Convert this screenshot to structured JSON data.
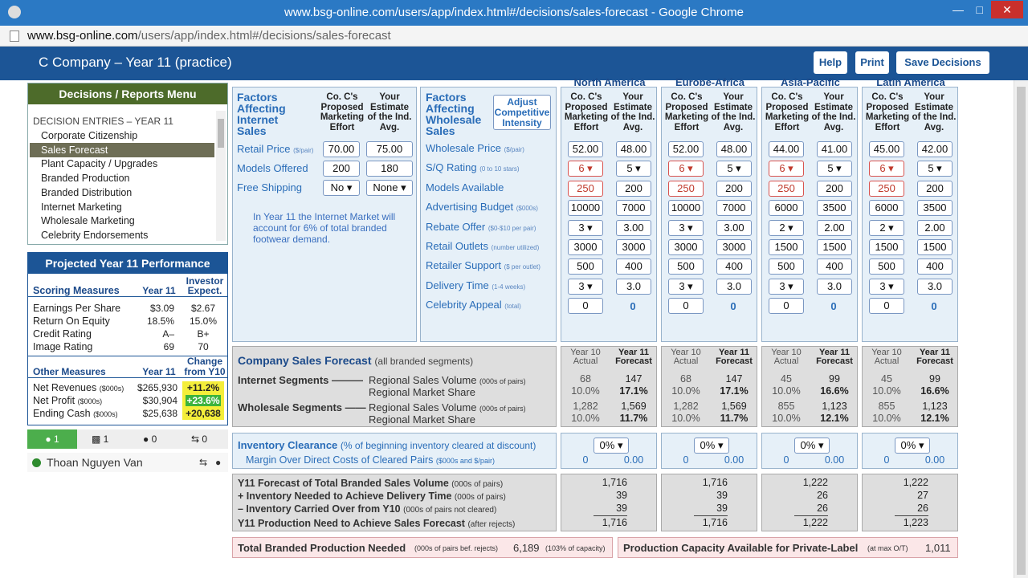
{
  "browser": {
    "window_title": "www.bsg-online.com/users/app/index.html#/decisions/sales-forecast - Google Chrome",
    "url_host": "www.bsg-online.com",
    "url_path": "/users/app/index.html#/decisions/sales-forecast"
  },
  "header": {
    "company": "C Company – Year 11 (practice)",
    "help": "Help",
    "print": "Print",
    "save": "Save Decisions"
  },
  "menu": {
    "title": "Decisions / Reports Menu",
    "section": "DECISION  ENTRIES – YEAR 11",
    "items": [
      "Corporate Citizenship",
      "Sales Forecast",
      "Plant Capacity / Upgrades",
      "Branded Production",
      "Branded Distribution",
      "Internet Marketing",
      "Wholesale Marketing",
      "Celebrity Endorsements"
    ],
    "selected": 1
  },
  "perf": {
    "title": "Projected Year 11 Performance",
    "scoring_hdr": "Scoring Measures",
    "year_hdr": "Year 11",
    "investor_hdr1": "Investor",
    "investor_hdr2": "Expect.",
    "scoring": [
      {
        "label": "Earnings Per Share",
        "y11": "$3.09",
        "exp": "$2.67"
      },
      {
        "label": "Return On Equity",
        "y11": "18.5%",
        "exp": "15.0%"
      },
      {
        "label": "Credit Rating",
        "y11": "A–",
        "exp": "B+"
      },
      {
        "label": "Image Rating",
        "y11": "69",
        "exp": "70"
      }
    ],
    "other_hdr": "Other Measures",
    "change_hdr1": "Change",
    "change_hdr2": "from Y10",
    "other": [
      {
        "label": "Net Revenues",
        "unit": "($000s)",
        "y11": "$265,930",
        "chg": "+11.2%"
      },
      {
        "label": "Net Profit",
        "unit": "($000s)",
        "y11": "$30,904",
        "chg": "+23.6%"
      },
      {
        "label": "Ending Cash",
        "unit": "($000s)",
        "y11": "$25,638",
        "chg": "+20,638"
      }
    ]
  },
  "social": {
    "people": "1",
    "comments": "1",
    "mic": "0",
    "share": "0",
    "user": "Thoan Nguyen Van"
  },
  "internet": {
    "title": "Factors Affecting Internet Sales",
    "h1": "Co. C's Proposed Marketing Effort",
    "h2": "Your Estimate of the Ind. Avg.",
    "rows": [
      {
        "label": "Retail Price",
        "unit": "($/pair)",
        "a": "70.00",
        "b": "75.00"
      },
      {
        "label": "Models Offered",
        "unit": "",
        "a": "200",
        "b": "180"
      },
      {
        "label": "Free Shipping",
        "unit": "",
        "a": "No",
        "b": "None"
      }
    ],
    "note": "In Year 11 the Internet Market will account for 6% of total branded footwear demand."
  },
  "wholesale": {
    "title": "Factors Affecting Wholesale Sales",
    "adjust": "Adjust Competitive Intensity",
    "rows": [
      {
        "label": "Wholesale Price",
        "unit": "($/pair)"
      },
      {
        "label": "S/Q Rating",
        "unit": "(0 to 10 stars)"
      },
      {
        "label": "Models Available",
        "unit": ""
      },
      {
        "label": "Advertising Budget",
        "unit": "($000s)"
      },
      {
        "label": "Rebate Offer",
        "unit": "($0-$10 per pair)"
      },
      {
        "label": "Retail Outlets",
        "unit": "(number utilized)"
      },
      {
        "label": "Retailer Support",
        "unit": "($ per outlet)"
      },
      {
        "label": "Delivery Time",
        "unit": "(1-4 weeks)"
      },
      {
        "label": "Celebrity Appeal",
        "unit": "(total)"
      }
    ]
  },
  "region_hdr": {
    "h1": "Co. C's Proposed Marketing Effort",
    "h2": "Your Estimate of the Ind. Avg."
  },
  "regions": [
    {
      "name": "North America",
      "vals": [
        [
          "52.00",
          "48.00"
        ],
        [
          "6",
          "5"
        ],
        [
          "250",
          "200"
        ],
        [
          "10000",
          "7000"
        ],
        [
          "3",
          "3.00"
        ],
        [
          "3000",
          "3000"
        ],
        [
          "500",
          "400"
        ],
        [
          "3",
          "3.0"
        ],
        [
          "0",
          "0"
        ]
      ],
      "fc": {
        "i_y10_vol": "68",
        "i_y11_vol": "147",
        "i_y10_sh": "10.0%",
        "i_y11_sh": "17.1%",
        "w_y10_vol": "1,282",
        "w_y11_vol": "1,569",
        "w_y10_sh": "10.0%",
        "w_y11_sh": "11.7%"
      },
      "inv": {
        "pct": "0%",
        "a": "0",
        "b": "0.00"
      },
      "tot": [
        "1,716",
        "39",
        "39",
        "1,716"
      ]
    },
    {
      "name": "Europe-Africa",
      "vals": [
        [
          "52.00",
          "48.00"
        ],
        [
          "6",
          "5"
        ],
        [
          "250",
          "200"
        ],
        [
          "10000",
          "7000"
        ],
        [
          "3",
          "3.00"
        ],
        [
          "3000",
          "3000"
        ],
        [
          "500",
          "400"
        ],
        [
          "3",
          "3.0"
        ],
        [
          "0",
          "0"
        ]
      ],
      "fc": {
        "i_y10_vol": "68",
        "i_y11_vol": "147",
        "i_y10_sh": "10.0%",
        "i_y11_sh": "17.1%",
        "w_y10_vol": "1,282",
        "w_y11_vol": "1,569",
        "w_y10_sh": "10.0%",
        "w_y11_sh": "11.7%"
      },
      "inv": {
        "pct": "0%",
        "a": "0",
        "b": "0.00"
      },
      "tot": [
        "1,716",
        "39",
        "39",
        "1,716"
      ]
    },
    {
      "name": "Asia-Pacific",
      "vals": [
        [
          "44.00",
          "41.00"
        ],
        [
          "6",
          "5"
        ],
        [
          "250",
          "200"
        ],
        [
          "6000",
          "3500"
        ],
        [
          "2",
          "2.00"
        ],
        [
          "1500",
          "1500"
        ],
        [
          "500",
          "400"
        ],
        [
          "3",
          "3.0"
        ],
        [
          "0",
          "0"
        ]
      ],
      "fc": {
        "i_y10_vol": "45",
        "i_y11_vol": "99",
        "i_y10_sh": "10.0%",
        "i_y11_sh": "16.6%",
        "w_y10_vol": "855",
        "w_y11_vol": "1,123",
        "w_y10_sh": "10.0%",
        "w_y11_sh": "12.1%"
      },
      "inv": {
        "pct": "0%",
        "a": "0",
        "b": "0.00"
      },
      "tot": [
        "1,222",
        "26",
        "26",
        "1,222"
      ]
    },
    {
      "name": "Latin America",
      "vals": [
        [
          "45.00",
          "42.00"
        ],
        [
          "6",
          "5"
        ],
        [
          "250",
          "200"
        ],
        [
          "6000",
          "3500"
        ],
        [
          "2",
          "2.00"
        ],
        [
          "1500",
          "1500"
        ],
        [
          "500",
          "400"
        ],
        [
          "3",
          "3.0"
        ],
        [
          "0",
          "0"
        ]
      ],
      "fc": {
        "i_y10_vol": "45",
        "i_y11_vol": "99",
        "i_y10_sh": "10.0%",
        "i_y11_sh": "16.6%",
        "w_y10_vol": "855",
        "w_y11_vol": "1,123",
        "w_y10_sh": "10.0%",
        "w_y11_sh": "12.1%"
      },
      "inv": {
        "pct": "0%",
        "a": "0",
        "b": "0.00"
      },
      "tot": [
        "1,222",
        "27",
        "26",
        "1,223"
      ]
    }
  ],
  "forecast": {
    "title": "Company Sales Forecast",
    "title_note": "(all branded segments)",
    "y10": "Year 10 Actual",
    "y11": "Year 11 Forecast",
    "internet": "Internet Segments ———",
    "wholesale": "Wholesale Segments ——",
    "vol": "Regional Sales Volume",
    "vol_unit": "(000s of pairs)",
    "share": "Regional Market Share"
  },
  "inventory": {
    "title": "Inventory Clearance",
    "note": "(% of beginning inventory cleared at discount)",
    "margin": "Margin Over Direct Costs of Cleared Pairs",
    "margin_unit": "($000s and $/pair)"
  },
  "totals": {
    "l1": "Y11 Forecast of Total Branded Sales Volume",
    "u1": "(000s of pairs)",
    "l2": "+ Inventory Needed to Achieve Delivery Time",
    "u2": "(000s of pairs)",
    "l3": "– Inventory Carried Over from Y10",
    "u3": "(000s of pairs not cleared)",
    "l4": "Y11 Production Need to Achieve Sales Forecast",
    "u4": "(after rejects)"
  },
  "bottom": {
    "tbp": "Total Branded Production Needed",
    "tbp_unit": "(000s of pairs bef. rejects)",
    "tbp_val": "6,189",
    "tbp_pct": "(103% of capacity)",
    "pca": "Production Capacity Available for Private-Label",
    "pca_unit": "(at max O/T)",
    "pca_val": "1,011"
  }
}
